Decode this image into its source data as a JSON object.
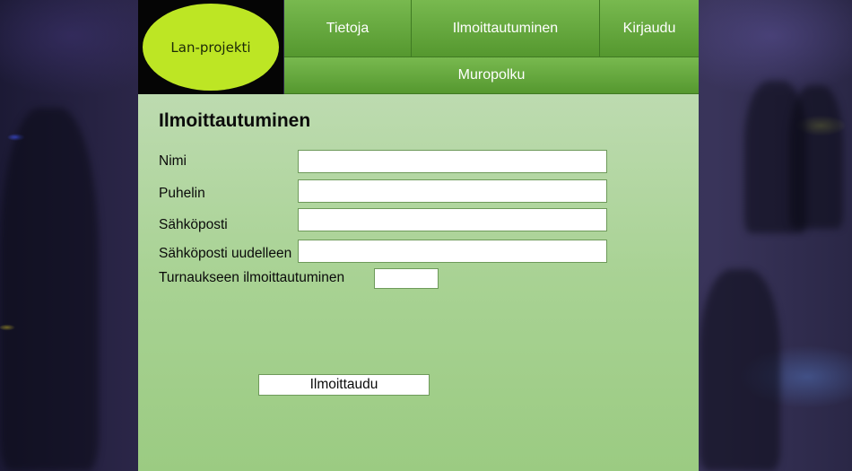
{
  "logo": {
    "text": "Lan-projekti"
  },
  "nav": {
    "items": [
      {
        "label": "Tietoja"
      },
      {
        "label": "Ilmoittautuminen"
      },
      {
        "label": "Kirjaudu"
      }
    ],
    "breadcrumb": "Muropolku"
  },
  "form": {
    "title": "Ilmoittautuminen",
    "fields": {
      "name": {
        "label": "Nimi",
        "value": ""
      },
      "phone": {
        "label": "Puhelin",
        "value": ""
      },
      "email": {
        "label": "Sähköposti",
        "value": ""
      },
      "email_repeat": {
        "label": "Sähköposti uudelleen",
        "value": ""
      },
      "tournament": {
        "label": "Turnaukseen ilmoittautuminen",
        "value": ""
      }
    },
    "submit_label": "Ilmoittaudu"
  },
  "colors": {
    "nav_green": "#64a83c",
    "logo_lime": "#bde624",
    "panel_green": "#a8d293"
  }
}
